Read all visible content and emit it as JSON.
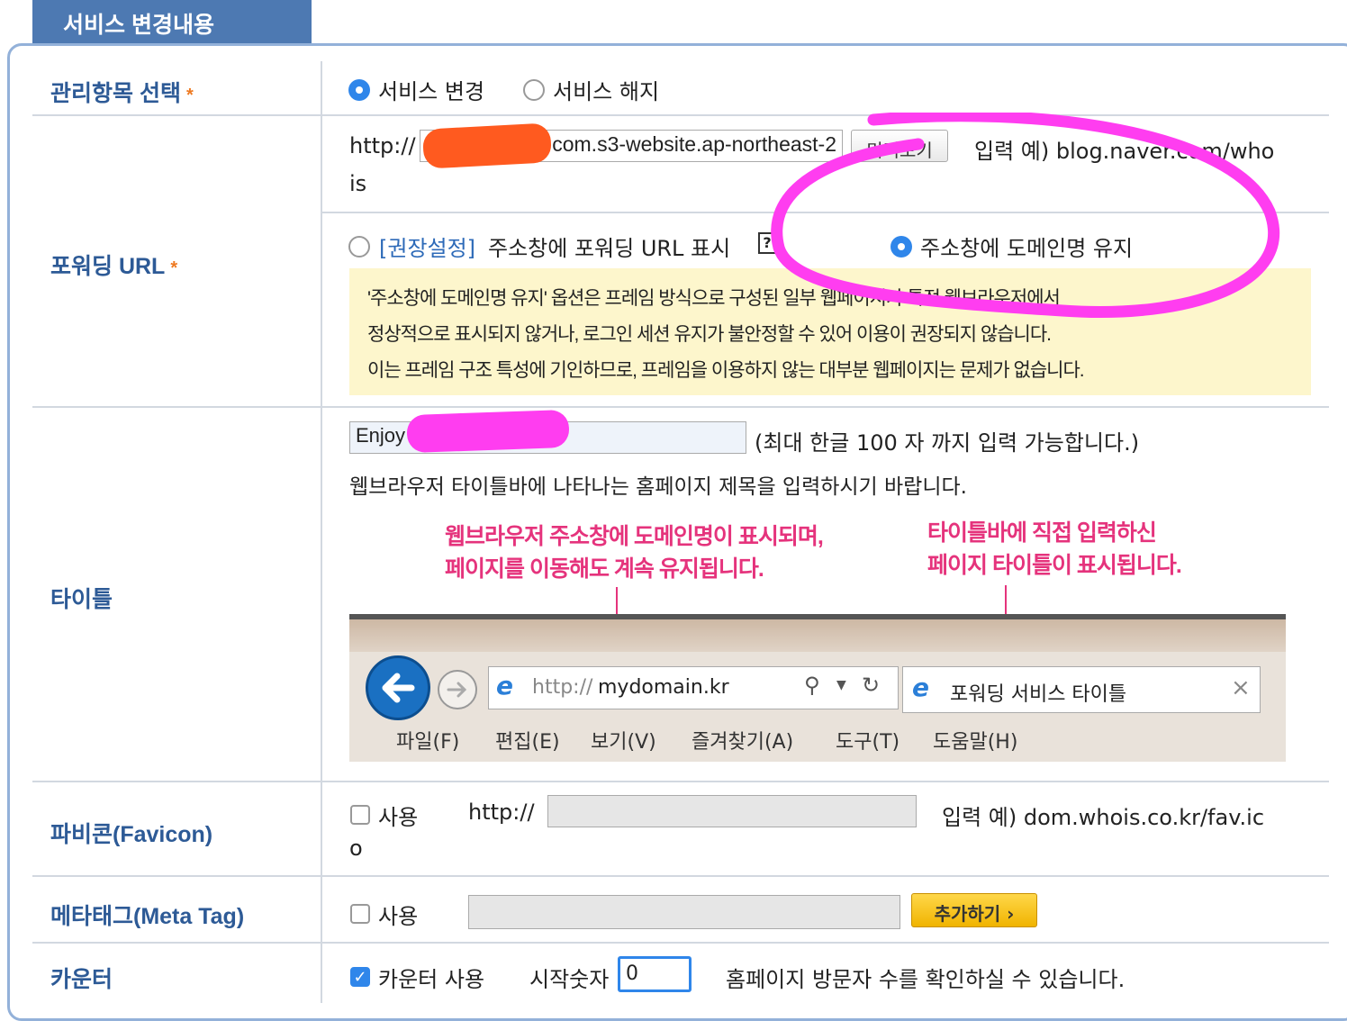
{
  "section_title": "서비스 변경내용",
  "rows": {
    "manage": {
      "label": "관리항목 선택",
      "required_mark": "*",
      "option_change": "서비스 변경",
      "option_cancel": "서비스 해지"
    },
    "forward_url": {
      "label": "포워딩 URL",
      "required_mark": "*",
      "prefix": "http://",
      "url_value": "com.s3-website.ap-northeast-2",
      "preview_button": "미리보기",
      "example_line1": "입력 예) blog.naver.com/who",
      "example_line2": "is",
      "option_recommended_tag": "[권장설정]",
      "option_recommended_text": "주소창에 포워딩 URL 표시",
      "help_icon": "?",
      "option_keep_domain": "주소창에 도메인명 유지",
      "notice_line1": "'주소창에 도메인명 유지' 옵션은 프레임 방식으로 구성된 일부 웹페이지가 특정 웹브라우저에서",
      "notice_line2": "정상적으로 표시되지 않거나, 로그인 세션 유지가 불안정할 수 있어 이용이 권장되지 않습니다.",
      "notice_line3": "이는 프레임 구조 특성에 기인하므로, 프레임을 이용하지 않는 대부분 웹페이지는 문제가 없습니다."
    },
    "title": {
      "label": "타이틀",
      "input_value": "Enjoy",
      "limit_note": "(최대 한글 100 자 까지 입력 가능합니다.)",
      "desc": "웹브라우저 타이틀바에 나타나는 홈페이지 제목을 입력하시기 바랍니다.",
      "callout_left_1": "웹브라우저 주소창에 도메인명이 표시되며,",
      "callout_left_2": "페이지를 이동해도 계속 유지됩니다.",
      "callout_right_1": "타이틀바에 직접 입력하신",
      "callout_right_2": "페이지 타이틀이 표시됩니다.",
      "browser": {
        "address_prefix": "http://",
        "address_domain": "mydomain.kr",
        "tab_title": "포워딩 서비스 타이틀",
        "tab_close": "×",
        "menu": [
          "파일(F)",
          "편집(E)",
          "보기(V)",
          "즐겨찾기(A)",
          "도구(T)",
          "도움말(H)"
        ]
      }
    },
    "favicon": {
      "label": "파비콘(Favicon)",
      "use_label": "사용",
      "prefix": "http://",
      "example_line1": "입력 예) dom.whois.co.kr/fav.ic",
      "example_line2": "o"
    },
    "meta": {
      "label": "메타태그(Meta Tag)",
      "use_label": "사용",
      "add_button": "추가하기 ›"
    },
    "counter": {
      "label": "카운터",
      "use_label": "카운터 사용",
      "start_label": "시작숫자",
      "start_value": "0",
      "desc": "홈페이지 방문자 수를 확인하실 수 있습니다."
    }
  },
  "colors": {
    "tab_bg": "#4d79b2",
    "label_blue": "#2d5a96",
    "required_orange": "#ee7a22",
    "notice_bg": "#fdf6cc",
    "callout_pink": "#e5337c",
    "radio_blue": "#2f86ea",
    "button_yellow": "#f0b400",
    "annotation_magenta": "#ff3df0",
    "redaction_orange": "#ff5a1f"
  }
}
